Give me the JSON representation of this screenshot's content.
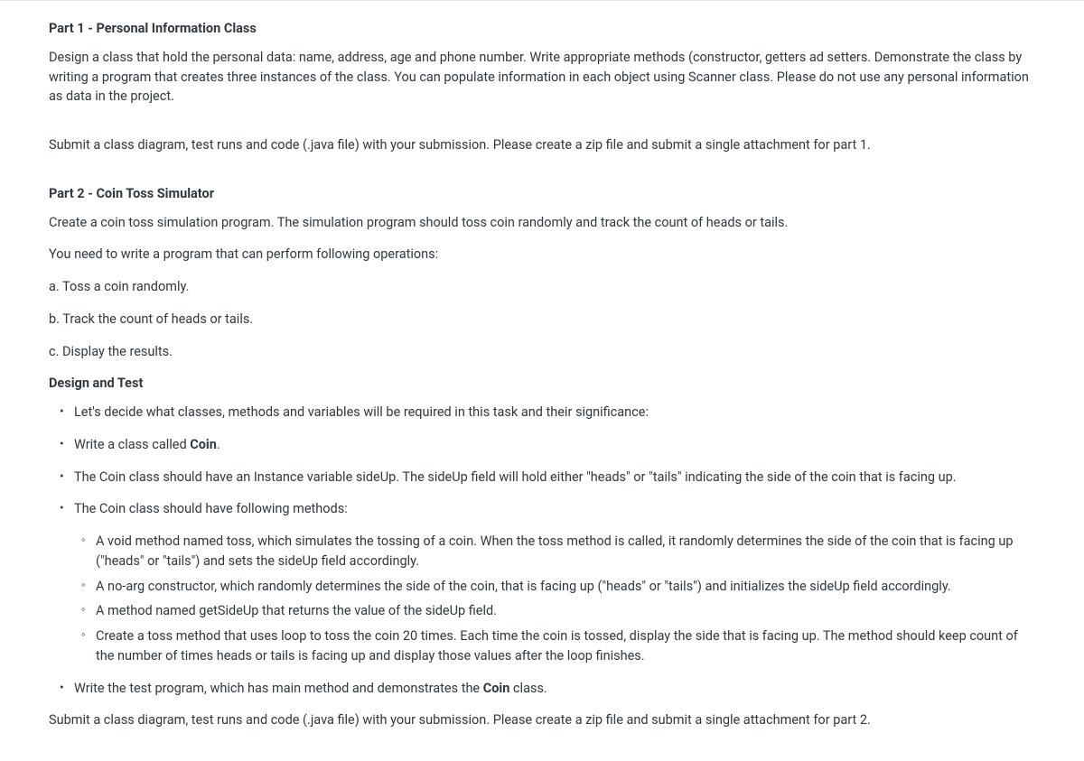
{
  "part1": {
    "title": "Part 1 - Personal Information Class",
    "p1": "Design  a class that hold the personal data: name, address, age and phone number. Write appropriate methods (constructor, getters ad setters. Demonstrate the class by writing a program that creates three instances of the class. You can populate information in each object using Scanner class. Please do not use any personal information as data in the project.",
    "p2": "Submit a class diagram, test runs and code (.java file) with your submission. Please create a zip file and submit a single attachment for part 1."
  },
  "part2": {
    "title": "Part 2 -  Coin Toss Simulator",
    "intro": "Create a coin toss simulation program. The simulation program should toss coin randomly and track the count of heads or tails.",
    "need": " You need to write a program that can perform following operations:",
    "ops": {
      "a": "a. Toss a coin randomly.",
      "b": "b. Track the count of heads or tails.",
      "c": "c. Display the results."
    },
    "designTitle": "Design and Test",
    "bullets": {
      "b1": "Let's decide what classes, methods and variables will be required in this task and their significance:",
      "b2_pre": "Write a class called ",
      "b2_bold": "Coin",
      "b2_post": ".",
      "b3": "The Coin class should have an Instance variable sideUp. The sideUp field will hold either \"heads\" or \"tails\" indicating the side of the coin that is facing up.",
      "b4": "The Coin class should have following methods:",
      "sub": {
        "s1": " A void method named toss, which simulates the tossing of a coin. When the toss method is called, it randomly determines the side of the coin that is facing up (\"heads\" or \"tails\") and sets the sideUp field accordingly.",
        "s2": "A no-arg constructor, which randomly determines the side of the coin, that is facing up (\"heads\" or \"tails\") and initializes the sideUp field accordingly.",
        "s3": "A method named getSideUp that returns the value of the sideUp field.",
        "s4": "Create a toss method that uses loop to toss the coin 20 times. Each time the coin is tossed, display the side that is facing up. The method should keep count of the number of times heads or tails is facing up and display those values after the loop finishes."
      },
      "b5_pre": "Write the test program, which has main method and demonstrates the ",
      "b5_bold": "Coin",
      "b5_post": " class."
    },
    "submit": "Submit a class diagram, test runs and code (.java file) with your submission. Please create a zip file and submit a single attachment for part 2."
  }
}
